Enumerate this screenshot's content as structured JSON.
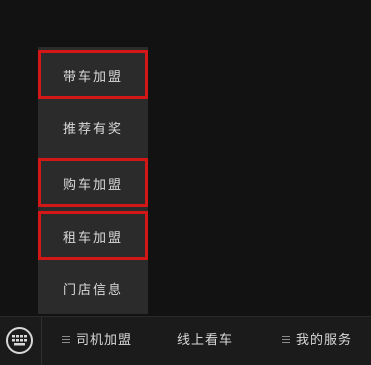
{
  "submenu": {
    "items": [
      {
        "label": "带车加盟",
        "highlighted": true
      },
      {
        "label": "推荐有奖",
        "highlighted": false
      },
      {
        "label": "购车加盟",
        "highlighted": true
      },
      {
        "label": "租车加盟",
        "highlighted": true
      },
      {
        "label": "门店信息",
        "highlighted": false
      }
    ],
    "highlight_color": "#d31616"
  },
  "bottom_bar": {
    "keyboard_icon": "keyboard-icon",
    "tabs": [
      {
        "label": "司机加盟",
        "icon": "menu-icon"
      },
      {
        "label": "线上看车",
        "icon": ""
      },
      {
        "label": "我的服务",
        "icon": "menu-icon"
      }
    ]
  }
}
